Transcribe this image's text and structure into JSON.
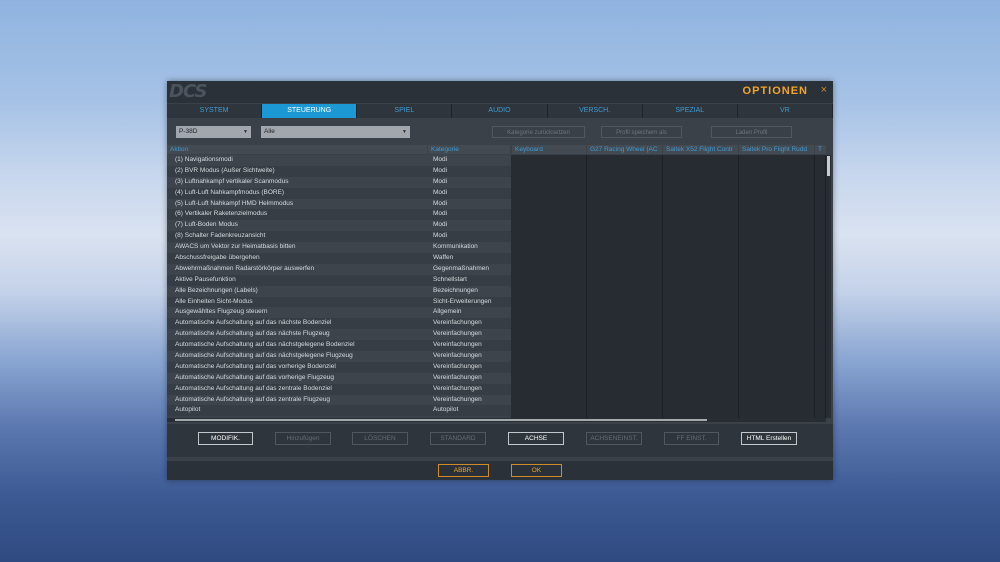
{
  "window": {
    "logo": "DCS",
    "title": "OPTIONEN",
    "close": "×"
  },
  "tabs": [
    "SYSTEM",
    "STEUERUNG",
    "SPIEL",
    "AUDIO",
    "VERSCH.",
    "SPEZIAL",
    "VR"
  ],
  "active_tab": "STEUERUNG",
  "filters": {
    "aircraft": "P-38D",
    "category": "Alle",
    "reset_category": "Kategorie zurücksetzen",
    "save_profile": "Profil speichern als",
    "load_profile": "Laden Profil"
  },
  "columns": {
    "action": "Aktion",
    "category": "Kategorie",
    "devices": [
      "Keyboard",
      "G27 Racing Wheel {AC",
      "Saitek X52 Flight Contr",
      "Saitek Pro Flight Rudd",
      "T"
    ]
  },
  "rows": [
    [
      "(1) Navigationsmodi",
      "Modi"
    ],
    [
      "(2) BVR Modus (Außer Sichtweite)",
      "Modi"
    ],
    [
      "(3) Luftnahkampf vertikaler Scanmodus",
      "Modi"
    ],
    [
      "(4) Luft-Luft Nahkampfmodus (BORE)",
      "Modi"
    ],
    [
      "(5) Luft-Luft Nahkampf HMD Helmmodus",
      "Modi"
    ],
    [
      "(6) Vertikaler Raketenzielmodus",
      "Modi"
    ],
    [
      "(7) Luft-Boden Modus",
      "Modi"
    ],
    [
      "(8) Schalter Fadenkreuzansicht",
      "Modi"
    ],
    [
      "AWACS um Vektor zur Heimatbasis bitten",
      "Kommunikation"
    ],
    [
      "Abschussfreigabe übergehen",
      "Waffen"
    ],
    [
      "Abwehrmaßnahmen Radarstörkörper auswerfen",
      "Gegenmaßnahmen"
    ],
    [
      "Aktive Pausefunktion",
      "Schnellstart"
    ],
    [
      "Alle Bezeichnungen (Labels)",
      "Bezeichnungen"
    ],
    [
      "Alle Einheiten Sicht-Modus",
      "Sicht-Erweiterungen"
    ],
    [
      "Ausgewähltes Flugzeug steuern",
      "Allgemein"
    ],
    [
      "Automatische Aufschaltung auf das nächste Bodenziel",
      "Vereinfachungen"
    ],
    [
      "Automatische Aufschaltung auf das nächste Flugzeug",
      "Vereinfachungen"
    ],
    [
      "Automatische Aufschaltung auf das nächstgelegene Bodenziel",
      "Vereinfachungen"
    ],
    [
      "Automatische Aufschaltung auf das nächstgelegene Flugzeug",
      "Vereinfachungen"
    ],
    [
      "Automatische Aufschaltung auf das vorherige Bodenziel",
      "Vereinfachungen"
    ],
    [
      "Automatische Aufschaltung auf das vorherige Flugzeug",
      "Vereinfachungen"
    ],
    [
      "Automatische Aufschaltung auf das zentrale Bodenziel",
      "Vereinfachungen"
    ],
    [
      "Automatische Aufschaltung auf das zentrale Flugzeug",
      "Vereinfachungen"
    ],
    [
      "Autopilot",
      "Autopilot"
    ]
  ],
  "buttons": {
    "modify": "MODIFIK.",
    "add": "Hinzufügen",
    "delete": "LÖSCHEN",
    "default": "STANDARD",
    "axis": "ACHSE",
    "axis_settings": "ACHSENEINST.",
    "ff_settings": "FF EINST.",
    "html": "HTML Erstellen"
  },
  "footer": {
    "cancel": "ABBR.",
    "ok": "OK"
  },
  "colors": {
    "accent": "#1c98d4",
    "title": "#f0a52c"
  }
}
